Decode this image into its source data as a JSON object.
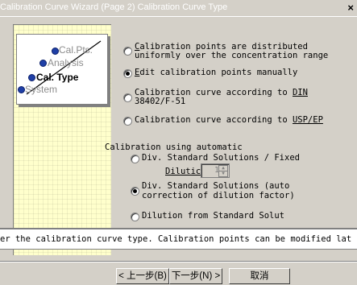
{
  "window": {
    "title": "Calibration Curve Wizard (Page 2) Calibration Curve Type",
    "close_glyph": "×"
  },
  "steps": [
    "Cal.Pts.",
    "Analysis",
    "Cal. Type",
    "System"
  ],
  "options": {
    "o1_line1_hot": "C",
    "o1_line1_rest": "alibration points are distributed",
    "o1_line2": "uniformly over the concentration range",
    "o2_hot": "E",
    "o2_rest": "dit calibration points manually",
    "o3_line1_pre": "Calibration curve according to ",
    "o3_line1_hot": "DIN",
    "o3_line2": "38402/F-51",
    "o4_pre": "Calibration curve according to ",
    "o4_hot": "USP/EP"
  },
  "auto": {
    "label": "Calibration using automatic",
    "a1": "Div. Standard Solutions / Fixed",
    "dilution_label": "Dilutic",
    "dilution_value": "1",
    "a2_line1": "Div. Standard Solutions (auto",
    "a2_line2": "correction of dilution factor)",
    "a3": "Dilution from Standard Solut"
  },
  "hint": "er the calibration curve type. Calibration points can be modified lat",
  "buttons": {
    "back": "< 上一步(B)",
    "next": "下一步(N) >",
    "cancel": "取消"
  },
  "colors": {
    "panel": "#ffffcc",
    "dialog": "#d4d0c8",
    "step_dot": "#1f3fa6"
  }
}
